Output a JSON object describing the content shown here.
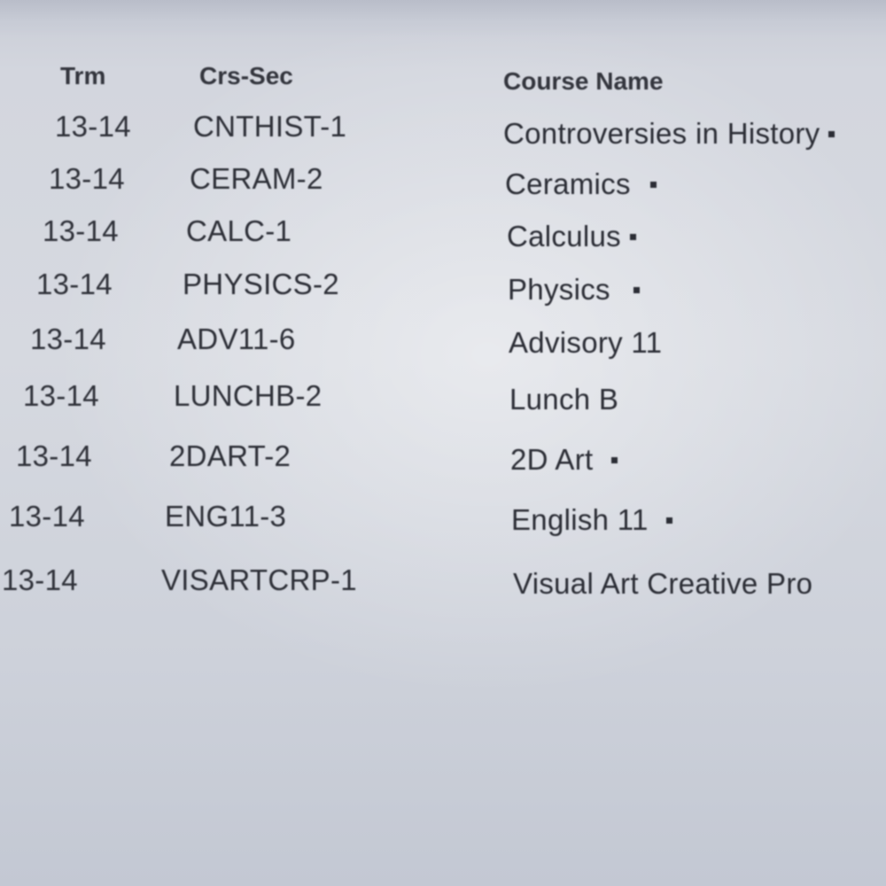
{
  "table": {
    "headers": {
      "term": "Trm",
      "course_section": "Crs-Sec",
      "course_name": "Course Name"
    },
    "rows": [
      {
        "term": "13-14",
        "course_section": "CNTHIST-1",
        "course_name": "Controversies in History",
        "marked": true
      },
      {
        "term": "13-14",
        "course_section": "CERAM-2",
        "course_name": "Ceramics",
        "marked": true
      },
      {
        "term": "13-14",
        "course_section": "CALC-1",
        "course_name": "Calculus",
        "marked": true
      },
      {
        "term": "13-14",
        "course_section": "PHYSICS-2",
        "course_name": "Physics",
        "marked": true
      },
      {
        "term": "13-14",
        "course_section": "ADV11-6",
        "course_name": "Advisory 11",
        "marked": false
      },
      {
        "term": "13-14",
        "course_section": "LUNCHB-2",
        "course_name": "Lunch B",
        "marked": false
      },
      {
        "term": "13-14",
        "course_section": "2DART-2",
        "course_name": "2D Art",
        "marked": true
      },
      {
        "term": "13-14",
        "course_section": "ENG11-3",
        "course_name": "English 11",
        "marked": true
      },
      {
        "term": "13-14",
        "course_section": "VISARTCRP-1",
        "course_name": "Visual Art Creative Pro",
        "marked": false
      }
    ]
  }
}
